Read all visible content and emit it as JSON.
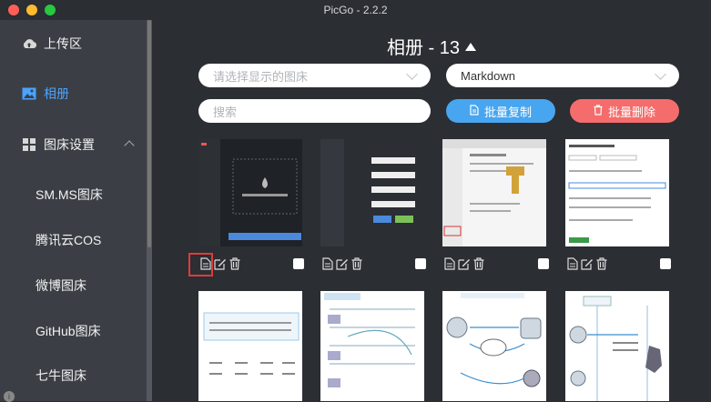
{
  "window": {
    "title": "PicGo - 2.2.2"
  },
  "sidebar": {
    "items": [
      {
        "label": "上传区",
        "icon": "cloud-upload-icon"
      },
      {
        "label": "相册",
        "icon": "image-icon",
        "active": true
      },
      {
        "label": "图床设置",
        "icon": "grid-icon"
      }
    ],
    "sub_items": [
      "SM.MS图床",
      "腾讯云COS",
      "微博图床",
      "GitHub图床",
      "七牛图床"
    ]
  },
  "main": {
    "heading": "相册 - 13",
    "bed_select": {
      "placeholder": "请选择显示的图床"
    },
    "format_select": {
      "value": "Markdown"
    },
    "search": {
      "placeholder": "搜索"
    },
    "copy_button": "批量复制",
    "delete_button": "批量删除",
    "colors": {
      "copy": "#48a6f0",
      "delete": "#f56c6c",
      "active": "#4aa3ff"
    }
  }
}
